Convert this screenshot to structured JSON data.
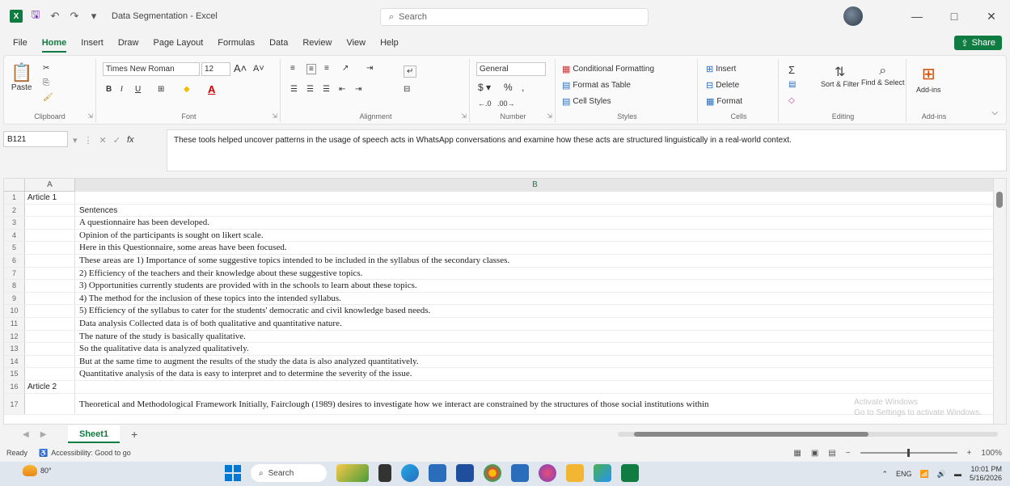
{
  "window": {
    "title": "Data Segmentation  -  Excel",
    "search_placeholder": "Search",
    "minimize": "—",
    "restore": "□",
    "close": "✕"
  },
  "menu": {
    "items": [
      "File",
      "Home",
      "Insert",
      "Draw",
      "Page Layout",
      "Formulas",
      "Data",
      "Review",
      "View",
      "Help"
    ],
    "active": "Home",
    "share_label": "Share"
  },
  "ribbon": {
    "clipboard": {
      "label": "Clipboard",
      "paste": "Paste"
    },
    "font": {
      "label": "Font",
      "font_name": "Times New Roman",
      "font_size": "12"
    },
    "alignment": {
      "label": "Alignment"
    },
    "number": {
      "label": "Number",
      "format": "General"
    },
    "styles": {
      "label": "Styles",
      "conditional": "Conditional Formatting",
      "format_table": "Format as Table",
      "cell_styles": "Cell Styles"
    },
    "cells": {
      "label": "Cells",
      "insert": "Insert",
      "delete": "Delete",
      "format": "Format"
    },
    "editing": {
      "label": "Editing",
      "sort_filter": "Sort & Filter",
      "find_select": "Find & Select"
    },
    "addins": {
      "label": "Add-ins",
      "addins_btn": "Add-ins"
    }
  },
  "formula_bar": {
    "name_box": "B121",
    "content": "These tools helped uncover patterns in the usage of speech acts in WhatsApp conversations and examine how these acts are structured linguistically in a real-world context."
  },
  "grid": {
    "col_a": "A",
    "col_b": "B",
    "rows": [
      {
        "n": "1",
        "a": "Article 1",
        "b": "",
        "sans": false
      },
      {
        "n": "2",
        "a": "",
        "b": "Sentences",
        "sans": true
      },
      {
        "n": "3",
        "a": "",
        "b": "A questionnaire has been developed.",
        "sans": false
      },
      {
        "n": "4",
        "a": "",
        "b": "Opinion of the participants is sought on likert scale.",
        "sans": false
      },
      {
        "n": "5",
        "a": "",
        "b": "Here in this Questionnaire, some areas have been focused.",
        "sans": false
      },
      {
        "n": "6",
        "a": "",
        "b": "These areas are 1) Importance of some suggestive topics intended to be included in the syllabus of the secondary classes.",
        "sans": false
      },
      {
        "n": "7",
        "a": "",
        "b": "2) Efficiency of the teachers and their knowledge about these suggestive topics.",
        "sans": false
      },
      {
        "n": "8",
        "a": "",
        "b": "3) Opportunities currently students are provided with in the schools to learn about these topics.",
        "sans": false
      },
      {
        "n": "9",
        "a": "",
        "b": "4) The method for the inclusion of these topics into the intended syllabus.",
        "sans": false
      },
      {
        "n": "10",
        "a": "",
        "b": "5) Efficiency of the syllabus to cater for the students' democratic and civil knowledge based needs.",
        "sans": false
      },
      {
        "n": "11",
        "a": "",
        "b": "Data analysis Collected data is of both qualitative and quantitative nature.",
        "sans": false
      },
      {
        "n": "12",
        "a": "",
        "b": "The nature of the study is basically qualitative.",
        "sans": false
      },
      {
        "n": "13",
        "a": "",
        "b": "So the qualitative data is analyzed qualitatively.",
        "sans": false
      },
      {
        "n": "14",
        "a": "",
        "b": "But at the same time to augment the results of the study the data is also analyzed quantitatively.",
        "sans": false
      },
      {
        "n": "15",
        "a": "",
        "b": "Quantitative analysis of the data is easy to interpret and to determine the severity of the issue.",
        "sans": false
      },
      {
        "n": "16",
        "a": "Article 2",
        "b": "",
        "sans": false
      },
      {
        "n": "17",
        "a": "",
        "b": "Theoretical and Methodological Framework Initially, Fairclough (1989) desires to investigate how we interact are constrained by the structures of those social institutions within",
        "sans": false
      }
    ],
    "watermark_line1": "Activate Windows",
    "watermark_line2": "Go to Settings to activate Windows."
  },
  "sheets": {
    "tabs": [
      "Sheet1"
    ],
    "add": "+"
  },
  "status": {
    "ready": "Ready",
    "accessibility": "Accessibility: Good to go",
    "zoom": "100%"
  },
  "taskbar": {
    "weather_temp": "80°",
    "search_label": "Search",
    "lang": "ENG",
    "time": "10:01 PM",
    "date": "5/16/2026"
  }
}
